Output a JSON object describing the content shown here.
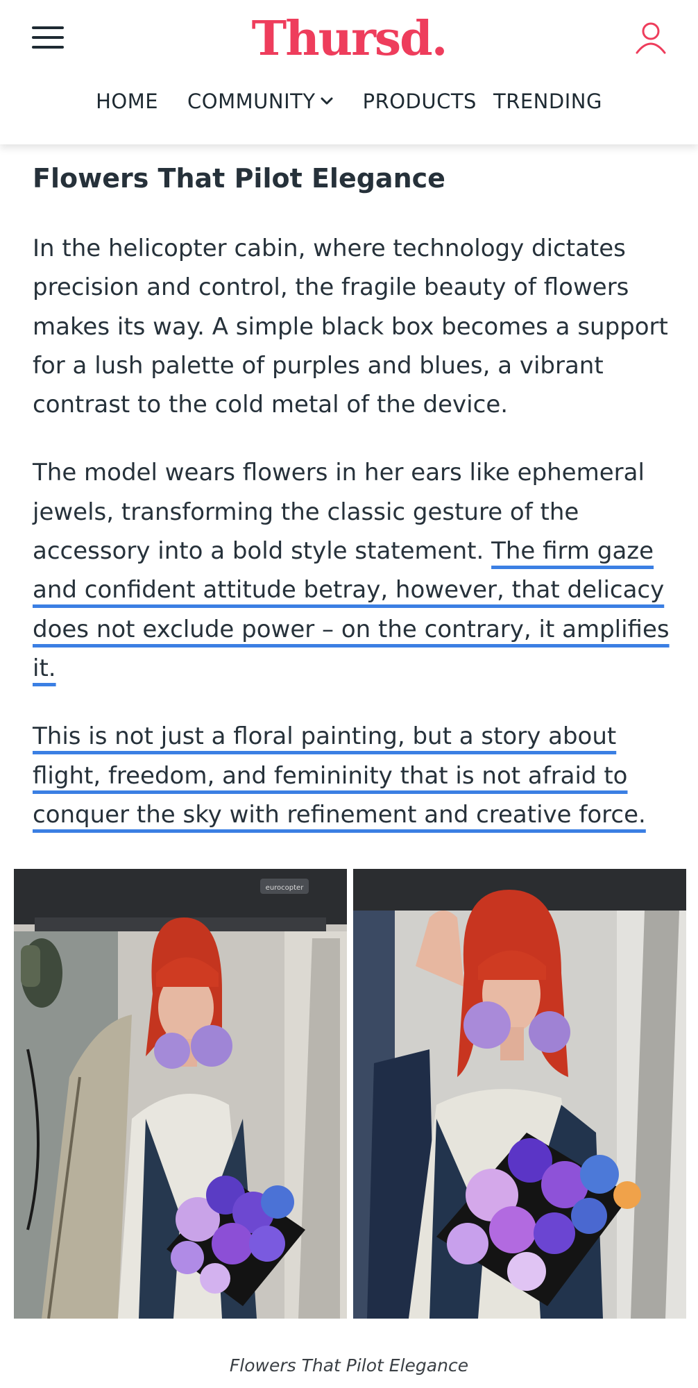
{
  "header": {
    "logo_text": "Thursd.",
    "brand_color": "#ee3d5c",
    "menu_icon": "hamburger-menu-icon",
    "user_icon": "user-account-icon",
    "nav": [
      {
        "label": "HOME"
      },
      {
        "label": "COMMUNITY",
        "has_dropdown": true
      },
      {
        "label": "PRODUCTS"
      },
      {
        "label": "TRENDING"
      }
    ]
  },
  "article": {
    "section_title": "Flowers That Pilot Elegance",
    "paragraph_1": "In the helicopter cabin, where technology dictates precision and control, the fragile beauty of flowers makes its way. A simple black box becomes a support for a lush palette of purples and blues, a vibrant contrast to the cold metal of the device.",
    "paragraph_2_plain": "The model wears flowers in her ears like ephemeral jewels, transforming the classic gesture of the accessory into a bold style statement.",
    "paragraph_2_highlight": "The firm gaze and confident attitude betray, however, that delicacy does not exclude power – on the contrary, it amplifies it.",
    "paragraph_3_highlight": "This is not just a floral painting, but a story about flight, freedom, and femininity that is not afraid to conquer the sky with refinement and creative force.",
    "highlight_color": "#3b7fe3"
  },
  "gallery": {
    "left_badge": "eurocopter",
    "caption": "Flowers That Pilot Elegance"
  }
}
